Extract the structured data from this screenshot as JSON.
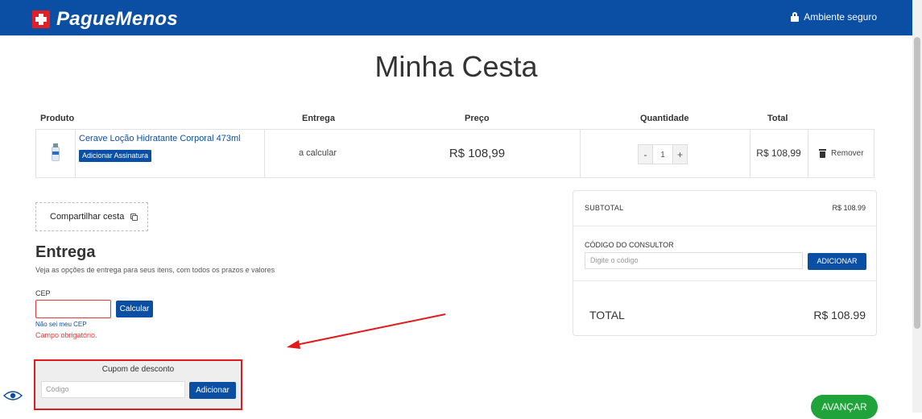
{
  "header": {
    "brand": "PagueMenos",
    "secure_label": "Ambiente seguro"
  },
  "page": {
    "title": "Minha Cesta"
  },
  "table": {
    "columns": [
      "Produto",
      "Entrega",
      "Preço",
      "Quantidade",
      "Total"
    ],
    "items": [
      {
        "name": "Cerave Loção Hidratante Corporal 473ml",
        "subscription_label": "Adicionar Assinatura",
        "delivery": "a calcular",
        "price": "R$ 108,99",
        "quantity": "1",
        "total": "R$ 108,99",
        "remove_label": "Remover"
      }
    ]
  },
  "share": {
    "label": "Compartilhar cesta"
  },
  "delivery": {
    "title": "Entrega",
    "subtitle": "Veja as opções de entrega para seus itens, com todos os prazos e valores",
    "cep_label": "CEP",
    "cep_value": "",
    "calc_label": "Calcular",
    "unknown_cep": "Não sei meu CEP",
    "error": "Campo obrigatório."
  },
  "coupon": {
    "title": "Cupom de desconto",
    "placeholder": "Código",
    "button": "Adicionar"
  },
  "summary": {
    "subtotal_label": "SUBTOTAL",
    "subtotal_value": "R$ 108.99",
    "consultant_label": "CÓDIGO DO CONSULTOR",
    "consultant_placeholder": "Digite o código",
    "consultant_button": "ADICIONAR",
    "total_label": "TOTAL",
    "total_value": "R$ 108.99"
  },
  "next_button": "AVANÇAR",
  "colors": {
    "primary": "#0b4fa4",
    "accent_red": "#e31f26",
    "success": "#1fa33a",
    "error": "#e53935"
  }
}
